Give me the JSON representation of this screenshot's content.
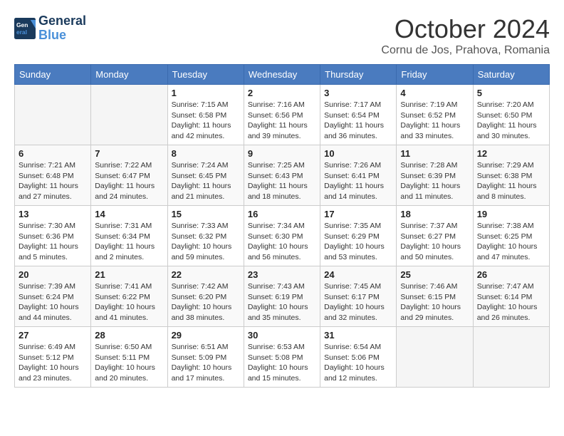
{
  "header": {
    "logo_line1": "General",
    "logo_line2": "Blue",
    "month_title": "October 2024",
    "subtitle": "Cornu de Jos, Prahova, Romania"
  },
  "days_of_week": [
    "Sunday",
    "Monday",
    "Tuesday",
    "Wednesday",
    "Thursday",
    "Friday",
    "Saturday"
  ],
  "weeks": [
    [
      {
        "day": "",
        "empty": true
      },
      {
        "day": "",
        "empty": true
      },
      {
        "day": "1",
        "sunrise": "Sunrise: 7:15 AM",
        "sunset": "Sunset: 6:58 PM",
        "daylight": "Daylight: 11 hours and 42 minutes."
      },
      {
        "day": "2",
        "sunrise": "Sunrise: 7:16 AM",
        "sunset": "Sunset: 6:56 PM",
        "daylight": "Daylight: 11 hours and 39 minutes."
      },
      {
        "day": "3",
        "sunrise": "Sunrise: 7:17 AM",
        "sunset": "Sunset: 6:54 PM",
        "daylight": "Daylight: 11 hours and 36 minutes."
      },
      {
        "day": "4",
        "sunrise": "Sunrise: 7:19 AM",
        "sunset": "Sunset: 6:52 PM",
        "daylight": "Daylight: 11 hours and 33 minutes."
      },
      {
        "day": "5",
        "sunrise": "Sunrise: 7:20 AM",
        "sunset": "Sunset: 6:50 PM",
        "daylight": "Daylight: 11 hours and 30 minutes."
      }
    ],
    [
      {
        "day": "6",
        "sunrise": "Sunrise: 7:21 AM",
        "sunset": "Sunset: 6:48 PM",
        "daylight": "Daylight: 11 hours and 27 minutes."
      },
      {
        "day": "7",
        "sunrise": "Sunrise: 7:22 AM",
        "sunset": "Sunset: 6:47 PM",
        "daylight": "Daylight: 11 hours and 24 minutes."
      },
      {
        "day": "8",
        "sunrise": "Sunrise: 7:24 AM",
        "sunset": "Sunset: 6:45 PM",
        "daylight": "Daylight: 11 hours and 21 minutes."
      },
      {
        "day": "9",
        "sunrise": "Sunrise: 7:25 AM",
        "sunset": "Sunset: 6:43 PM",
        "daylight": "Daylight: 11 hours and 18 minutes."
      },
      {
        "day": "10",
        "sunrise": "Sunrise: 7:26 AM",
        "sunset": "Sunset: 6:41 PM",
        "daylight": "Daylight: 11 hours and 14 minutes."
      },
      {
        "day": "11",
        "sunrise": "Sunrise: 7:28 AM",
        "sunset": "Sunset: 6:39 PM",
        "daylight": "Daylight: 11 hours and 11 minutes."
      },
      {
        "day": "12",
        "sunrise": "Sunrise: 7:29 AM",
        "sunset": "Sunset: 6:38 PM",
        "daylight": "Daylight: 11 hours and 8 minutes."
      }
    ],
    [
      {
        "day": "13",
        "sunrise": "Sunrise: 7:30 AM",
        "sunset": "Sunset: 6:36 PM",
        "daylight": "Daylight: 11 hours and 5 minutes."
      },
      {
        "day": "14",
        "sunrise": "Sunrise: 7:31 AM",
        "sunset": "Sunset: 6:34 PM",
        "daylight": "Daylight: 11 hours and 2 minutes."
      },
      {
        "day": "15",
        "sunrise": "Sunrise: 7:33 AM",
        "sunset": "Sunset: 6:32 PM",
        "daylight": "Daylight: 10 hours and 59 minutes."
      },
      {
        "day": "16",
        "sunrise": "Sunrise: 7:34 AM",
        "sunset": "Sunset: 6:30 PM",
        "daylight": "Daylight: 10 hours and 56 minutes."
      },
      {
        "day": "17",
        "sunrise": "Sunrise: 7:35 AM",
        "sunset": "Sunset: 6:29 PM",
        "daylight": "Daylight: 10 hours and 53 minutes."
      },
      {
        "day": "18",
        "sunrise": "Sunrise: 7:37 AM",
        "sunset": "Sunset: 6:27 PM",
        "daylight": "Daylight: 10 hours and 50 minutes."
      },
      {
        "day": "19",
        "sunrise": "Sunrise: 7:38 AM",
        "sunset": "Sunset: 6:25 PM",
        "daylight": "Daylight: 10 hours and 47 minutes."
      }
    ],
    [
      {
        "day": "20",
        "sunrise": "Sunrise: 7:39 AM",
        "sunset": "Sunset: 6:24 PM",
        "daylight": "Daylight: 10 hours and 44 minutes."
      },
      {
        "day": "21",
        "sunrise": "Sunrise: 7:41 AM",
        "sunset": "Sunset: 6:22 PM",
        "daylight": "Daylight: 10 hours and 41 minutes."
      },
      {
        "day": "22",
        "sunrise": "Sunrise: 7:42 AM",
        "sunset": "Sunset: 6:20 PM",
        "daylight": "Daylight: 10 hours and 38 minutes."
      },
      {
        "day": "23",
        "sunrise": "Sunrise: 7:43 AM",
        "sunset": "Sunset: 6:19 PM",
        "daylight": "Daylight: 10 hours and 35 minutes."
      },
      {
        "day": "24",
        "sunrise": "Sunrise: 7:45 AM",
        "sunset": "Sunset: 6:17 PM",
        "daylight": "Daylight: 10 hours and 32 minutes."
      },
      {
        "day": "25",
        "sunrise": "Sunrise: 7:46 AM",
        "sunset": "Sunset: 6:15 PM",
        "daylight": "Daylight: 10 hours and 29 minutes."
      },
      {
        "day": "26",
        "sunrise": "Sunrise: 7:47 AM",
        "sunset": "Sunset: 6:14 PM",
        "daylight": "Daylight: 10 hours and 26 minutes."
      }
    ],
    [
      {
        "day": "27",
        "sunrise": "Sunrise: 6:49 AM",
        "sunset": "Sunset: 5:12 PM",
        "daylight": "Daylight: 10 hours and 23 minutes."
      },
      {
        "day": "28",
        "sunrise": "Sunrise: 6:50 AM",
        "sunset": "Sunset: 5:11 PM",
        "daylight": "Daylight: 10 hours and 20 minutes."
      },
      {
        "day": "29",
        "sunrise": "Sunrise: 6:51 AM",
        "sunset": "Sunset: 5:09 PM",
        "daylight": "Daylight: 10 hours and 17 minutes."
      },
      {
        "day": "30",
        "sunrise": "Sunrise: 6:53 AM",
        "sunset": "Sunset: 5:08 PM",
        "daylight": "Daylight: 10 hours and 15 minutes."
      },
      {
        "day": "31",
        "sunrise": "Sunrise: 6:54 AM",
        "sunset": "Sunset: 5:06 PM",
        "daylight": "Daylight: 10 hours and 12 minutes."
      },
      {
        "day": "",
        "empty": true
      },
      {
        "day": "",
        "empty": true
      }
    ]
  ]
}
